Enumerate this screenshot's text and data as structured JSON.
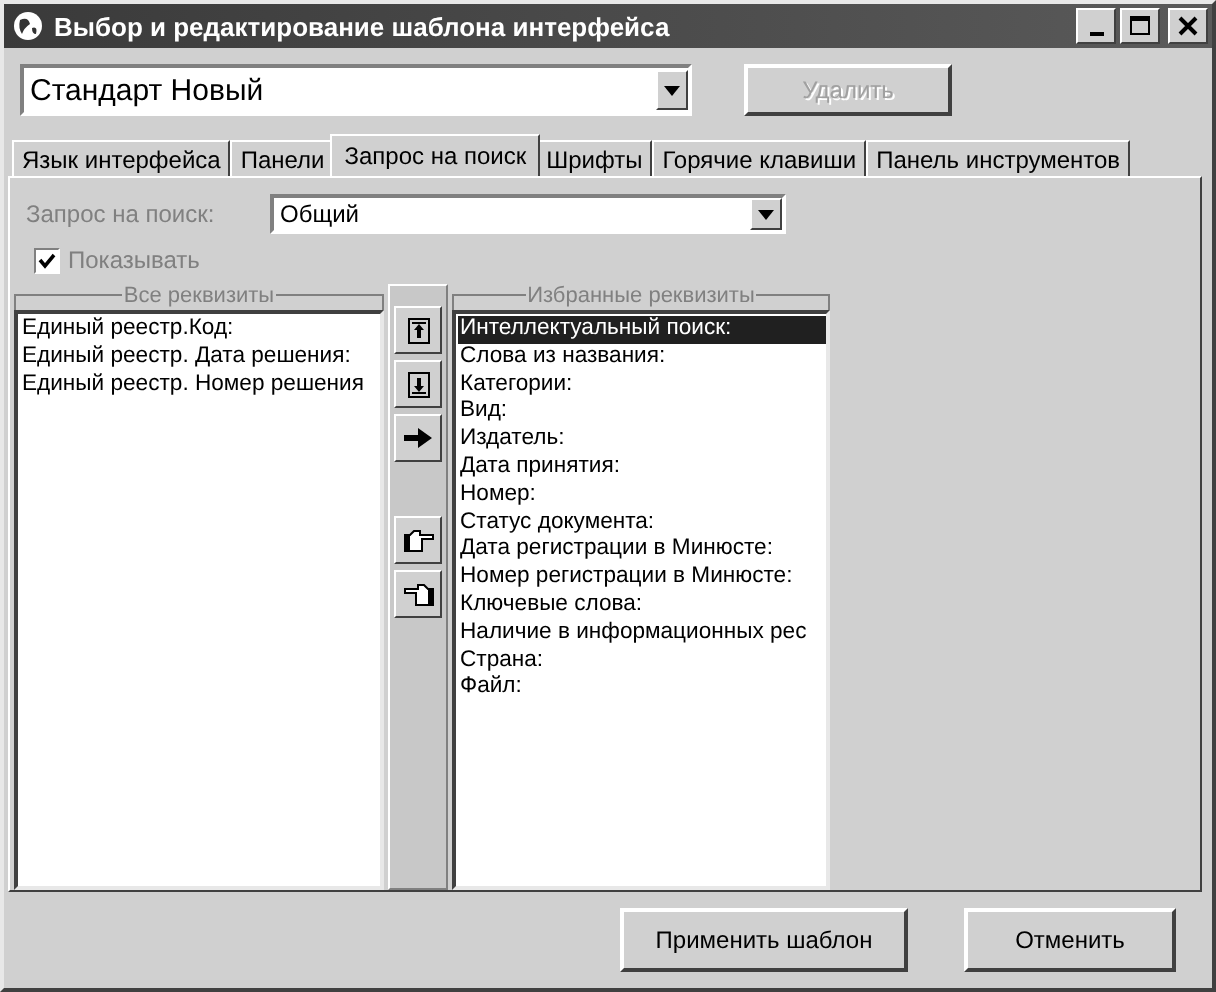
{
  "window": {
    "title": "Выбор и редактирование шаблона интерфейса"
  },
  "template": {
    "value": "Стандарт Новый"
  },
  "delete_button": {
    "label": "Удалить",
    "disabled": true
  },
  "tabs": [
    {
      "label": "Язык интерфейса",
      "selected": false
    },
    {
      "label": "Панели",
      "selected": false
    },
    {
      "label": "Запрос на поиск",
      "selected": true
    },
    {
      "label": "Шрифты",
      "selected": false
    },
    {
      "label": "Горячие клавиши",
      "selected": false
    },
    {
      "label": "Панель инструментов",
      "selected": false
    }
  ],
  "query": {
    "label": "Запрос на поиск:",
    "value": "Общий"
  },
  "show": {
    "label": "Показывать",
    "checked": true
  },
  "all_fields": {
    "title": "Все реквизиты",
    "items": [
      {
        "label": "Единый реестр.Код:",
        "selected": false
      },
      {
        "label": "Единый реестр. Дата решения:",
        "selected": false
      },
      {
        "label": "Единый реестр. Номер решения",
        "selected": false
      }
    ]
  },
  "chosen_fields": {
    "title": "Избранные реквизиты",
    "items": [
      {
        "label": "Интеллектуальный поиск:",
        "selected": true
      },
      {
        "label": "Слова из названия:",
        "selected": false
      },
      {
        "label": "Категории:",
        "selected": false
      },
      {
        "label": "Вид:",
        "selected": false
      },
      {
        "label": "Издатель:",
        "selected": false
      },
      {
        "label": "Дата принятия:",
        "selected": false
      },
      {
        "label": "Номер:",
        "selected": false
      },
      {
        "label": "Статус документа:",
        "selected": false
      },
      {
        "label": "Дата регистрации в Минюсте:",
        "selected": false
      },
      {
        "label": "Номер регистрации в Минюсте:",
        "selected": false
      },
      {
        "label": "Ключевые слова:",
        "selected": false
      },
      {
        "label": "Наличие в информационных рес",
        "selected": false
      },
      {
        "label": "Страна:",
        "selected": false
      },
      {
        "label": "Файл:",
        "selected": false
      }
    ]
  },
  "buttons": [
    {
      "label": "Применить шаблон"
    },
    {
      "label": "Отменить"
    }
  ]
}
